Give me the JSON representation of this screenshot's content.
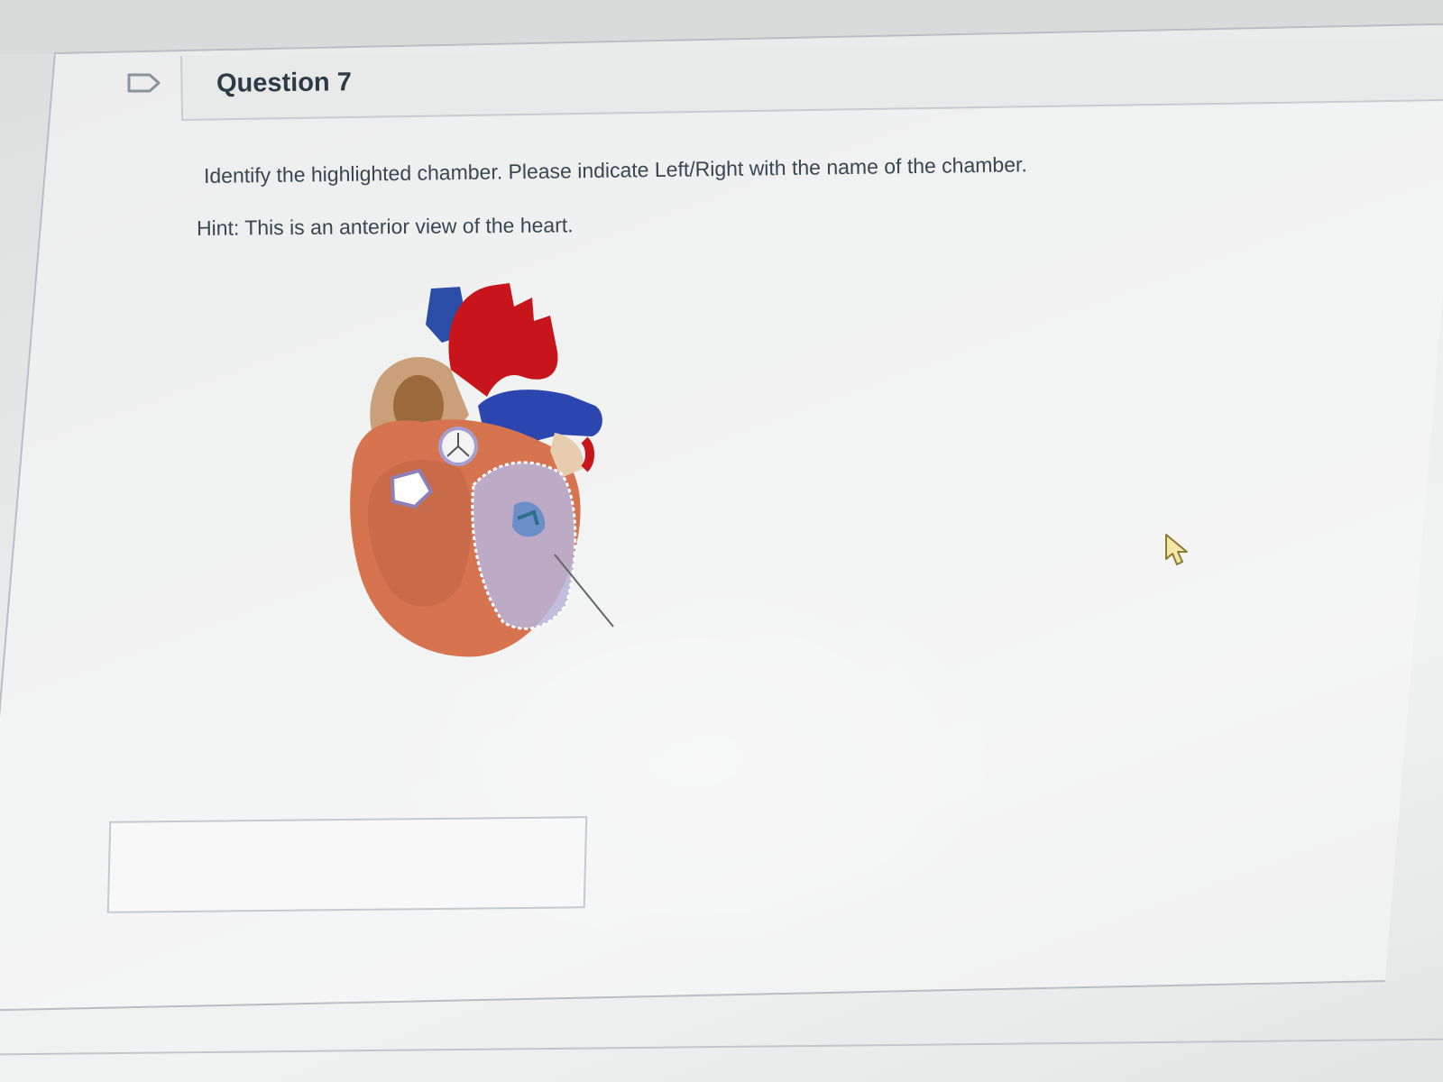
{
  "question": {
    "title": "Question 7",
    "prompt": "Identify the highlighted chamber. Please indicate Left/Right with the name of the chamber.",
    "hint": "Hint: This is an anterior view of the heart.",
    "answer_value": "",
    "bookmark_icon": "bookmark-flag-icon",
    "image_icon": "heart-anatomy-image"
  },
  "colors": {
    "heading": "#2d3b45",
    "body_text": "#3a4750",
    "card_border": "#b9bec4",
    "highlight": "#b8b4d8"
  }
}
